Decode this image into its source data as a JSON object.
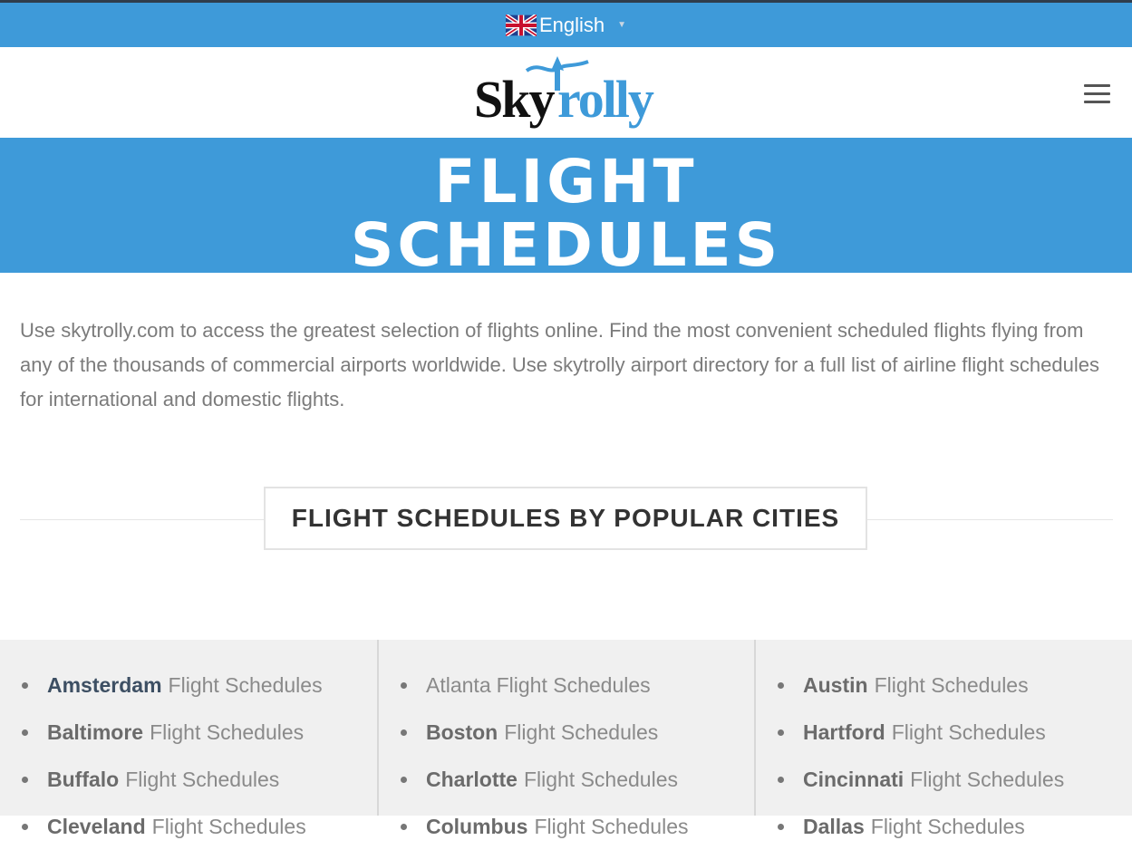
{
  "language": {
    "label": "English",
    "flag_icon": "uk-flag-icon"
  },
  "header": {
    "logo_sky": "Sky",
    "logo_rolly": "rolly",
    "menu_icon": "hamburger-menu-icon"
  },
  "banner": {
    "title_line1": "FLIGHT",
    "title_line2": "SCHEDULES"
  },
  "intro": {
    "text": "Use skytrolly.com to access the greatest selection of flights online. Find the most convenient scheduled flights flying from any of the thousands of commercial airports worldwide. Use skytrolly airport directory for a full list of airline flight schedules for international and domestic flights."
  },
  "section": {
    "title": "FLIGHT SCHEDULES BY POPULAR CITIES"
  },
  "cities": {
    "suffix": "Flight Schedules",
    "columns": [
      [
        {
          "name": "Amsterdam",
          "bold": true,
          "active": true
        },
        {
          "name": "Baltimore",
          "bold": true,
          "active": false
        },
        {
          "name": "Buffalo",
          "bold": true,
          "active": false
        },
        {
          "name": "Cleveland",
          "bold": true,
          "active": false
        }
      ],
      [
        {
          "name": "Atlanta",
          "bold": false,
          "active": false
        },
        {
          "name": "Boston",
          "bold": true,
          "active": false
        },
        {
          "name": "Charlotte",
          "bold": true,
          "active": false
        },
        {
          "name": "Columbus",
          "bold": true,
          "active": false
        }
      ],
      [
        {
          "name": "Austin",
          "bold": true,
          "active": false
        },
        {
          "name": "Hartford",
          "bold": true,
          "active": false
        },
        {
          "name": "Cincinnati",
          "bold": true,
          "active": false
        },
        {
          "name": "Dallas",
          "bold": true,
          "active": false
        }
      ]
    ]
  },
  "colors": {
    "brand_blue": "#3e9ad9",
    "link_dark": "#3d4f63",
    "text_gray": "#7b7b7b"
  }
}
